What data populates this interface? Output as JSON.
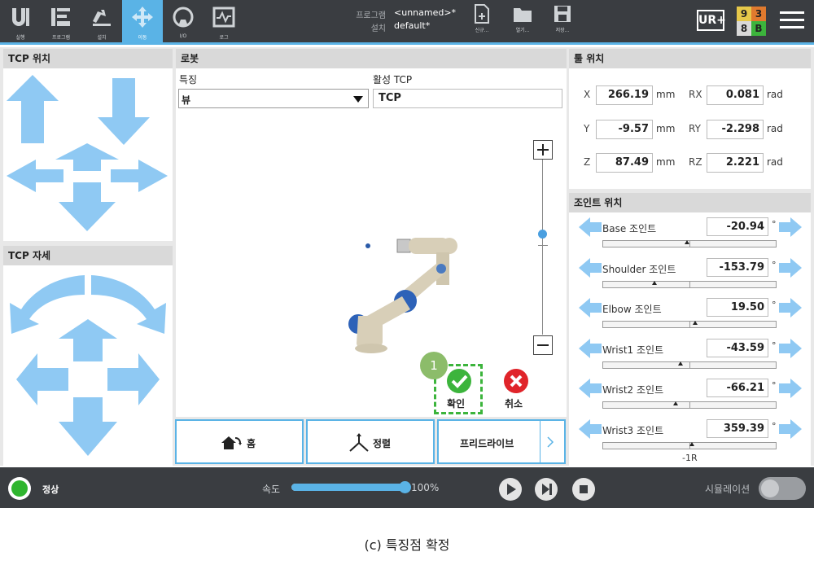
{
  "nav": {
    "items": [
      {
        "label": "실행",
        "icon": "run-icon"
      },
      {
        "label": "프로그램",
        "icon": "program-icon"
      },
      {
        "label": "설치",
        "icon": "installation-icon"
      },
      {
        "label": "이동",
        "icon": "move-icon"
      },
      {
        "label": "I/O",
        "icon": "io-icon"
      },
      {
        "label": "로그",
        "icon": "log-icon"
      }
    ],
    "active": "이동"
  },
  "program": {
    "program_key": "프로그램",
    "program_value": "<unnamed>*",
    "install_key": "설치",
    "install_value": "default*"
  },
  "file_buttons": {
    "new": "신규...",
    "open": "열기...",
    "save": "저장..."
  },
  "status_digits": {
    "d1": "9",
    "d2": "3",
    "d3": "8",
    "d4": "B",
    "colors": {
      "yellow": "#e6c84a",
      "orange": "#e07a2e",
      "gray": "#d9d9d9",
      "green": "#3cb43c"
    }
  },
  "tcp_position": {
    "title": "TCP 위치"
  },
  "tcp_orientation": {
    "title": "TCP 자세"
  },
  "robot": {
    "title": "로봇",
    "feature_label": "특징",
    "feature_value": "뷰",
    "active_tcp_label": "활성 TCP",
    "active_tcp_value": "TCP",
    "confirm_badge": "1",
    "confirm_label": "확인",
    "cancel_label": "취소"
  },
  "tool_position": {
    "title": "툴 위치",
    "x_label": "X",
    "x_value": "266.19",
    "x_unit": "mm",
    "y_label": "Y",
    "y_value": "-9.57",
    "y_unit": "mm",
    "z_label": "Z",
    "z_value": "87.49",
    "z_unit": "mm",
    "rx_label": "RX",
    "rx_value": "0.081",
    "rx_unit": "rad",
    "ry_label": "RY",
    "ry_value": "-2.298",
    "ry_unit": "rad",
    "rz_label": "RZ",
    "rz_value": "2.221",
    "rz_unit": "rad"
  },
  "joints": {
    "title": "조인트 위치",
    "unit": "°",
    "items": [
      {
        "label": "Base 조인트",
        "value": "-20.94"
      },
      {
        "label": "Shoulder 조인트",
        "value": "-153.79"
      },
      {
        "label": "Elbow 조인트",
        "value": "19.50"
      },
      {
        "label": "Wrist1 조인트",
        "value": "-43.59"
      },
      {
        "label": "Wrist2 조인트",
        "value": "-66.21"
      },
      {
        "label": "Wrist3 조인트",
        "value": "359.39"
      }
    ],
    "wrist3_extra": "-1R"
  },
  "bottom_buttons": {
    "home": "홈",
    "align": "정렬",
    "freedrive": "프리드라이브"
  },
  "status_bar": {
    "state": "정상",
    "speed_label": "속도",
    "speed_value": "100%",
    "speed_fraction": 1.0,
    "simulation_label": "시뮬레이션"
  },
  "caption": "(c) 특징점 확정",
  "colors": {
    "accent": "#5ab3e6",
    "topbar": "#3a3d41",
    "confirm_green": "#3cb43c",
    "cancel_red": "#e0242a",
    "dashed_green": "#3cb43c"
  }
}
